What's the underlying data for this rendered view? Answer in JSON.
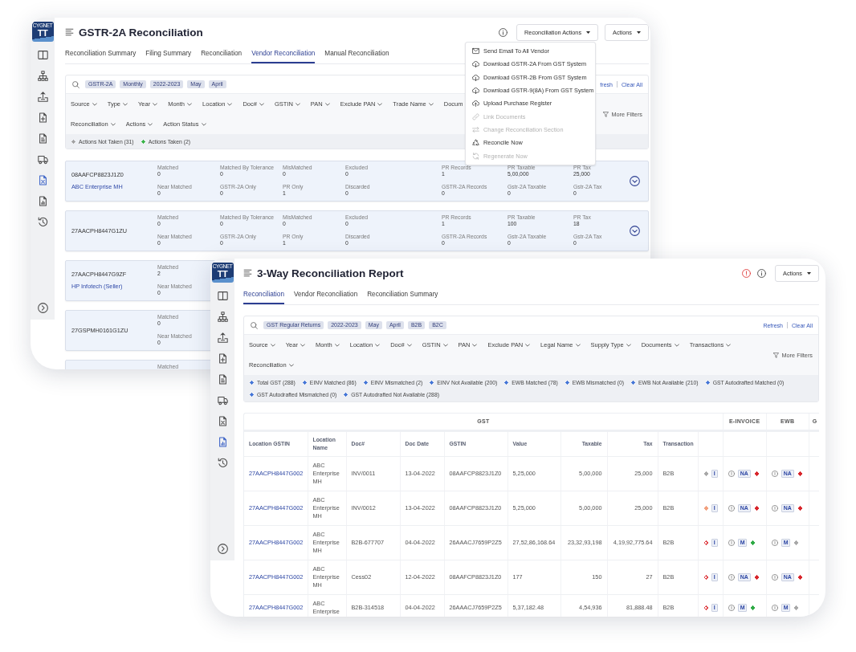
{
  "back_window": {
    "logo": {
      "brand": "CYGNET",
      "mark": "TT"
    },
    "sidebar": {
      "items": [
        {
          "selected": false
        },
        {
          "selected": false
        },
        {
          "selected": false
        },
        {
          "selected": false
        },
        {
          "selected": false
        },
        {
          "selected": false
        },
        {
          "selected": true
        },
        {
          "selected": false
        },
        {
          "selected": false
        }
      ]
    },
    "title": "GSTR-2A Reconciliation",
    "header_actions": [
      {
        "kind": "info"
      },
      {
        "kind": "dropdown",
        "label": "Reconciliation Actions",
        "menu": [
          {
            "label": "Send Email To All Vendor",
            "disabled": false
          },
          {
            "label": "Download GSTR-2A From GST System",
            "disabled": false
          },
          {
            "label": "Download GSTR-2B From GST System",
            "disabled": false
          },
          {
            "label": "Download GSTR-9(8A) From GST System",
            "disabled": false
          },
          {
            "label": "Upload Purchase Register",
            "disabled": false
          },
          {
            "label": "Link Documents",
            "disabled": true
          },
          {
            "label": "Change Reconciliation Section",
            "disabled": true
          },
          {
            "label": "Reconcile Now",
            "disabled": false
          },
          {
            "label": "Regenerate Now",
            "disabled": true
          }
        ]
      },
      {
        "kind": "dropdown",
        "label": "Actions"
      }
    ],
    "tabs": [
      {
        "label": "Reconciliation Summary",
        "selected": false
      },
      {
        "label": "Filing Summary",
        "selected": false
      },
      {
        "label": "Reconciliation",
        "selected": false
      },
      {
        "label": "Vendor Reconciliation",
        "selected": true
      },
      {
        "label": "Manual Reconciliation",
        "selected": false
      }
    ],
    "filter_panel": {
      "chips": [
        "GSTR-2A",
        "Monthly",
        "2022-2023",
        "May",
        "April"
      ],
      "links": [
        "fresh",
        "Clear All"
      ],
      "filter_rows": [
        {
          "filters": [
            "Source",
            "Type",
            "Year",
            "Month",
            "Location",
            "Doc#",
            "GSTIN",
            "PAN",
            "Exclude PAN",
            "Trade Name"
          ],
          "clipped_label": "Docum"
        },
        {
          "filters": [
            "Reconciliation",
            "Actions",
            "Action Status"
          ]
        }
      ],
      "more_filters": "More Filters",
      "legend": [
        {
          "label": "Actions Not Taken (31)",
          "color": "#a3a3a3"
        },
        {
          "label": "Actions Taken (2)",
          "color": "#3bb54a"
        }
      ]
    },
    "vendors": [
      {
        "gstin": "08AAFCP8823J1Z0",
        "name": "ABC Enterprise MH",
        "expanded": false,
        "stats": [
          [
            {
              "label": "Matched",
              "value": "0"
            },
            {
              "label": "Near Matched",
              "value": "0"
            }
          ],
          [
            {
              "label": "Matched By Tolerance",
              "value": "0"
            },
            {
              "label": "GSTR-2A Only",
              "value": "0"
            }
          ],
          [
            {
              "label": "MisMatched",
              "value": "0"
            },
            {
              "label": "PR Only",
              "value": "1"
            }
          ],
          [
            {
              "label": "Excluded",
              "value": "0"
            },
            {
              "label": "Discarded",
              "value": "0"
            }
          ],
          [
            {
              "label": "PR Records",
              "value": "1"
            },
            {
              "label": "GSTR-2A Records",
              "value": "0"
            }
          ],
          [
            {
              "label": "PR Taxable",
              "value": "5,00,000"
            },
            {
              "label": "Gstr-2A Taxable",
              "value": "0"
            }
          ],
          [
            {
              "label": "PR Tax",
              "value": "25,000"
            },
            {
              "label": "Gstr-2A Tax",
              "value": "0"
            }
          ]
        ]
      },
      {
        "gstin": "27AACPH8447G1ZU",
        "expanded": false,
        "stats": [
          [
            {
              "label": "Matched",
              "value": "0"
            },
            {
              "label": "Near Matched",
              "value": "0"
            }
          ],
          [
            {
              "label": "Matched By Tolerance",
              "value": "0"
            },
            {
              "label": "GSTR-2A Only",
              "value": "0"
            }
          ],
          [
            {
              "label": "MisMatched",
              "value": "0"
            },
            {
              "label": "PR Only",
              "value": "1"
            }
          ],
          [
            {
              "label": "Excluded",
              "value": "0"
            },
            {
              "label": "Discarded",
              "value": "0"
            }
          ],
          [
            {
              "label": "PR Records",
              "value": "1"
            },
            {
              "label": "GSTR-2A Records",
              "value": "0"
            }
          ],
          [
            {
              "label": "PR Taxable",
              "value": "100"
            },
            {
              "label": "Gstr-2A Taxable",
              "value": "0"
            }
          ],
          [
            {
              "label": "PR Tax",
              "value": "18"
            },
            {
              "label": "Gstr-2A Tax",
              "value": "0"
            }
          ]
        ]
      },
      {
        "gstin": "27AACPH8447G9ZF",
        "name": "HP Infotech (Seller)",
        "stats": [
          [
            {
              "label": "Matched",
              "value": "2"
            },
            {
              "label": "Near Matched",
              "value": "0"
            }
          ]
        ]
      },
      {
        "gstin": "27GSPMH0161G1ZU",
        "stats": [
          [
            {
              "label": "Matched",
              "value": "0"
            },
            {
              "label": "Near Matched",
              "value": "0"
            }
          ]
        ]
      },
      {
        "stats": [
          [
            {
              "label": "Matched"
            }
          ]
        ]
      }
    ]
  },
  "front_window": {
    "logo": {
      "brand": "CYGNET",
      "mark": "TT"
    },
    "sidebar": {
      "items": [
        {
          "selected": false
        },
        {
          "selected": false
        },
        {
          "selected": false
        },
        {
          "selected": false
        },
        {
          "selected": false
        },
        {
          "selected": false
        },
        {
          "selected": false
        },
        {
          "selected": true
        },
        {
          "selected": false
        }
      ]
    },
    "title": "3-Way Reconciliation Report",
    "header_actions": [
      {
        "kind": "alert"
      },
      {
        "kind": "info"
      },
      {
        "kind": "dropdown",
        "label": "Actions"
      }
    ],
    "tabs": [
      {
        "label": "Reconciliation",
        "selected": true
      },
      {
        "label": "Vendor Reconciliation",
        "selected": false
      },
      {
        "label": "Reconciliation Summary",
        "selected": false
      }
    ],
    "filter_panel": {
      "chips": [
        "GST Regular Returns",
        "2022-2023",
        "May",
        "April",
        "B2B",
        "B2C"
      ],
      "links": [
        "Refresh",
        "Clear All"
      ],
      "filter_rows": [
        {
          "filters": [
            "Source",
            "Year",
            "Month",
            "Location",
            "Doc#",
            "GSTIN",
            "PAN",
            "Exclude PAN",
            "Legal Name",
            "Supply Type",
            "Documents",
            "Transactions"
          ]
        },
        {
          "filters": [
            "Reconciliation"
          ]
        }
      ],
      "more_filters": "More Filters",
      "legend": [
        {
          "label": "Total GST (288)"
        },
        {
          "label": "EINV Matched (86)"
        },
        {
          "label": "EINV Mismatched (2)"
        },
        {
          "label": "EINV Not Available (200)"
        },
        {
          "label": "EWB Matched (78)"
        },
        {
          "label": "EWB Mismatched (0)"
        },
        {
          "label": "EWB Not Available (210)"
        },
        {
          "label": "GST Autodrafted Matched (0)"
        },
        {
          "label": "GST Autodrafted Mismatched (0)"
        },
        {
          "label": "GST Autodrafted Not Available (288)"
        }
      ]
    },
    "table": {
      "groups": [
        {
          "label": "GST"
        },
        {
          "label": "E-INVOICE"
        },
        {
          "label": "EWB"
        },
        {
          "label": "G"
        }
      ],
      "columns": [
        "Location GSTIN",
        "Location Name",
        "Doc#",
        "Doc Date",
        "GSTIN",
        "Value",
        "Taxable",
        "Tax",
        "Transaction"
      ],
      "rows": [
        {
          "cells": [
            "27AACPH8447G002",
            "ABC Enterprise MH",
            "INV/0011",
            "13-04-2022",
            "08AAFCP8823J1Z0",
            "5,25,000",
            "5,00,000",
            "25,000",
            "B2B"
          ],
          "status": {
            "kind": "solid",
            "color": "#a8a8a8",
            "badge": "I"
          },
          "e_invoice": {
            "badge": "NA",
            "color": "#d8262c"
          },
          "ewb": {
            "badge": "NA",
            "color": "#d8262c"
          }
        },
        {
          "cells": [
            "27AACPH8447G002",
            "ABC Enterprise MH",
            "INV/0012",
            "13-04-2022",
            "08AAFCP8823J1Z0",
            "5,25,000",
            "5,00,000",
            "25,000",
            "B2B"
          ],
          "status": {
            "kind": "solid",
            "color": "#f2a07e",
            "badge": "I"
          },
          "e_invoice": {
            "badge": "NA",
            "color": "#d8262c"
          },
          "ewb": {
            "badge": "NA",
            "color": "#d8262c"
          }
        },
        {
          "cells": [
            "27AACPH8447G002",
            "ABC Enterprise MH",
            "B2B-677707",
            "04-04-2022",
            "26AAACJ7659P2Z5",
            "27,52,86,168.64",
            "23,32,93,198",
            "4,19,92,775.64",
            "B2B"
          ],
          "status": {
            "kind": "outlined",
            "color": "#e0454a",
            "badge": "I"
          },
          "e_invoice": {
            "badge": "M",
            "color": "#2eaa45"
          },
          "ewb": {
            "badge": "M",
            "color": "#a8a8a8"
          }
        },
        {
          "cells": [
            "27AACPH8447G002",
            "ABC Enterprise MH",
            "Cess02",
            "12-04-2022",
            "08AAFCP8823J1Z0",
            "177",
            "150",
            "27",
            "B2B"
          ],
          "status": {
            "kind": "outlined",
            "color": "#e0454a",
            "badge": "I"
          },
          "e_invoice": {
            "badge": "NA",
            "color": "#d8262c"
          },
          "ewb": {
            "badge": "NA",
            "color": "#d8262c"
          }
        },
        {
          "cells": [
            "27AACPH8447G002",
            "ABC Enterprise",
            "B2B-314518",
            "04-04-2022",
            "26AAACJ7659P2Z5",
            "5,37,182.48",
            "4,54,936",
            "81,888.48",
            "B2B"
          ],
          "status": {
            "kind": "outlined",
            "color": "#e0454a",
            "badge": "I"
          },
          "e_invoice": {
            "badge": "M",
            "color": "#2eaa45"
          },
          "ewb": {
            "badge": "M",
            "color": "#a8a8a8"
          }
        }
      ]
    }
  }
}
